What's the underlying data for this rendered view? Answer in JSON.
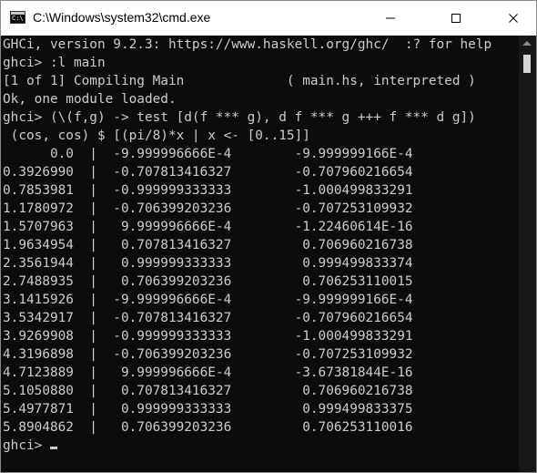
{
  "window": {
    "title": "C:\\Windows\\system32\\cmd.exe",
    "icon_text": "C:\\"
  },
  "controls": {
    "minimize": "minimize-icon",
    "maximize": "maximize-icon",
    "close": "close-icon"
  },
  "terminal": {
    "lines": [
      "GHCi, version 9.2.3: https://www.haskell.org/ghc/  :? for help",
      "ghci> :l main",
      "[1 of 1] Compiling Main             ( main.hs, interpreted )",
      "Ok, one module loaded.",
      "ghci> (\\(f,g) -> test [d(f *** g), d f *** g +++ f *** d g])",
      " (cos, cos) $ [(pi/8)*x | x <- [0..15]]",
      "      0.0  |  -9.999996666E-4        -9.999999166E-4",
      "0.3926990  |  -0.707813416327        -0.707960216654",
      "0.7853981  |  -0.999999333333        -1.000499833291",
      "1.1780972  |  -0.706399203236        -0.707253109932",
      "1.5707963  |   9.999996666E-4        -1.22460614E-16",
      "1.9634954  |   0.707813416327         0.706960216738",
      "2.3561944  |   0.999999333333         0.999499833374",
      "2.7488935  |   0.706399203236         0.706253110015",
      "3.1415926  |  -9.999996666E-4        -9.999999166E-4",
      "3.5342917  |  -0.707813416327        -0.707960216654",
      "3.9269908  |  -0.999999333333        -1.000499833291",
      "4.3196898  |  -0.706399203236        -0.707253109932",
      "4.7123889  |   9.999996666E-4        -3.67381844E-16",
      "5.1050880  |   0.707813416327         0.706960216738",
      "5.4977871  |   0.999999333333         0.999499833375",
      "5.8904862  |   0.706399203236         0.706253110016"
    ],
    "prompt": "ghci> "
  },
  "colors": {
    "terminal_bg": "#0c0c0c",
    "terminal_fg": "#cccccc",
    "titlebar_bg": "#ffffff"
  }
}
